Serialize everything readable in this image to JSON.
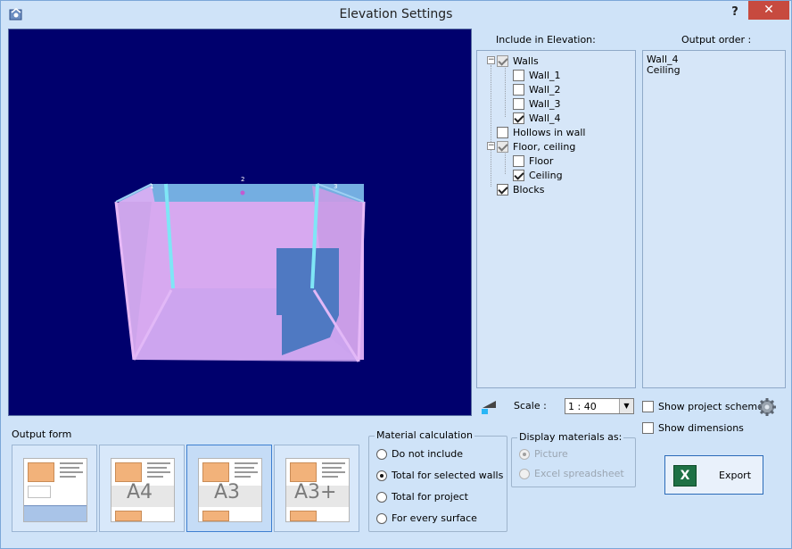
{
  "window": {
    "title": "Elevation Settings",
    "help_label": "?",
    "close_label": "✕"
  },
  "viewport": {
    "wall_labels": [
      "1",
      "2",
      "3"
    ]
  },
  "include": {
    "header": "Include in Elevation:",
    "items": [
      {
        "label": "Walls",
        "checked": true,
        "grey": true,
        "level": 0,
        "expander": "−"
      },
      {
        "label": "Wall_1",
        "checked": false,
        "level": 1
      },
      {
        "label": "Wall_2",
        "checked": false,
        "level": 1
      },
      {
        "label": "Wall_3",
        "checked": false,
        "level": 1
      },
      {
        "label": "Wall_4",
        "checked": true,
        "level": 1
      },
      {
        "label": "Hollows in wall",
        "checked": false,
        "level": 0
      },
      {
        "label": "Floor, ceiling",
        "checked": true,
        "grey": true,
        "level": 0,
        "expander": "−"
      },
      {
        "label": "Floor",
        "checked": false,
        "level": 1
      },
      {
        "label": "Ceiling",
        "checked": true,
        "level": 1
      },
      {
        "label": "Blocks",
        "checked": true,
        "level": 0
      }
    ]
  },
  "output_order": {
    "header": "Output order :",
    "items": [
      "Wall_4",
      "Ceiling"
    ]
  },
  "scale": {
    "label": "Scale :",
    "value": "1 : 40",
    "arrow": "▼"
  },
  "options": {
    "show_project_scheme": {
      "label": "Show project scheme",
      "checked": false
    },
    "show_dimensions": {
      "label": "Show dimensions",
      "checked": false
    }
  },
  "output_form": {
    "label": "Output form",
    "cards": [
      {
        "name": "output-form-scheme",
        "big": "",
        "selected": false
      },
      {
        "name": "output-form-a4",
        "big": "A4",
        "selected": false
      },
      {
        "name": "output-form-a3",
        "big": "A3",
        "selected": true
      },
      {
        "name": "output-form-a3plus",
        "big": "A3+",
        "selected": false
      }
    ]
  },
  "material_calculation": {
    "title": "Material calculation",
    "options": [
      {
        "label": "Do not include",
        "selected": false
      },
      {
        "label": "Total for selected walls",
        "selected": true
      },
      {
        "label": "Total for project",
        "selected": false
      },
      {
        "label": "For every surface",
        "selected": false
      }
    ]
  },
  "display_materials": {
    "title": "Display materials as:",
    "options": [
      {
        "label": "Picture",
        "selected": true,
        "disabled": true
      },
      {
        "label": "Excel spreadsheet",
        "selected": false,
        "disabled": true
      }
    ]
  },
  "export": {
    "label": "Export",
    "icon_letter": "X"
  },
  "colors": {
    "viewport_bg": "#00006d",
    "wall_pink": "#d6a6f0",
    "window_bg": "#cfe3f8"
  }
}
